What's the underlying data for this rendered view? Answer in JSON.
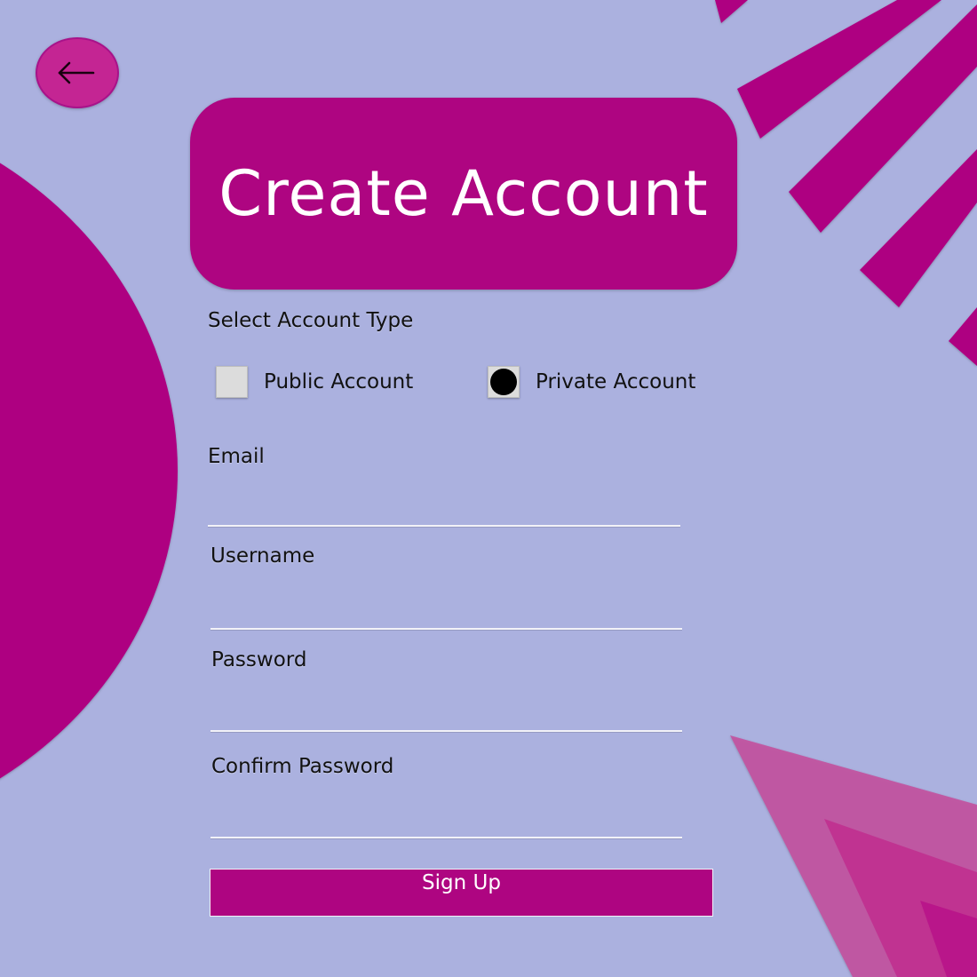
{
  "colors": {
    "background": "#abb1df",
    "accent": "#ae0581",
    "back_button": "#c42593",
    "decor_triangle": "#c2519f",
    "input_line": "#f2f2f8"
  },
  "header": {
    "back_icon": "arrow-left-icon",
    "title": "Create Account"
  },
  "account_type": {
    "label": "Select Account Type",
    "options": [
      {
        "label": "Public Account",
        "selected": false
      },
      {
        "label": "Private Account",
        "selected": true
      }
    ]
  },
  "form": {
    "email": {
      "label": "Email",
      "value": ""
    },
    "username": {
      "label": "Username",
      "value": ""
    },
    "password": {
      "label": "Password",
      "value": ""
    },
    "confirm_password": {
      "label": "Confirm Password",
      "value": ""
    },
    "submit_label": "Sign Up"
  }
}
